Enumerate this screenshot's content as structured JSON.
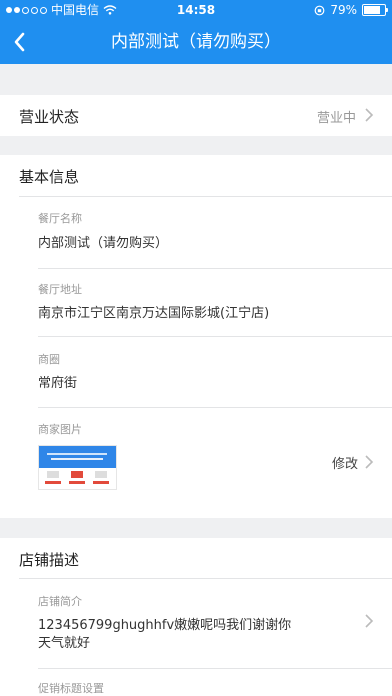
{
  "status_bar": {
    "carrier": "中国电信",
    "time": "14:58",
    "battery": "79%",
    "battery_level": 0.79
  },
  "nav": {
    "title": "内部测试（请勿购买）"
  },
  "business_status": {
    "label": "营业状态",
    "value": "营业中"
  },
  "basic_info": {
    "title": "基本信息",
    "restaurant_name_label": "餐厅名称",
    "restaurant_name": "内部测试（请勿购买）",
    "address_label": "餐厅地址",
    "address": "南京市江宁区南京万达国际影城(江宁店)",
    "district_label": "商圈",
    "district": "常府街",
    "photo_label": "商家图片",
    "photo_edit": "修改"
  },
  "store_desc": {
    "title": "店铺描述",
    "intro_label": "店铺简介",
    "intro_line1": "123456799ghughhfv嫩嫩呢吗我们谢谢你",
    "intro_line2": "天气就好",
    "promo_label": "促销标题设置"
  },
  "colors": {
    "brand": "#1f8ff0",
    "background": "#eff0f2"
  }
}
